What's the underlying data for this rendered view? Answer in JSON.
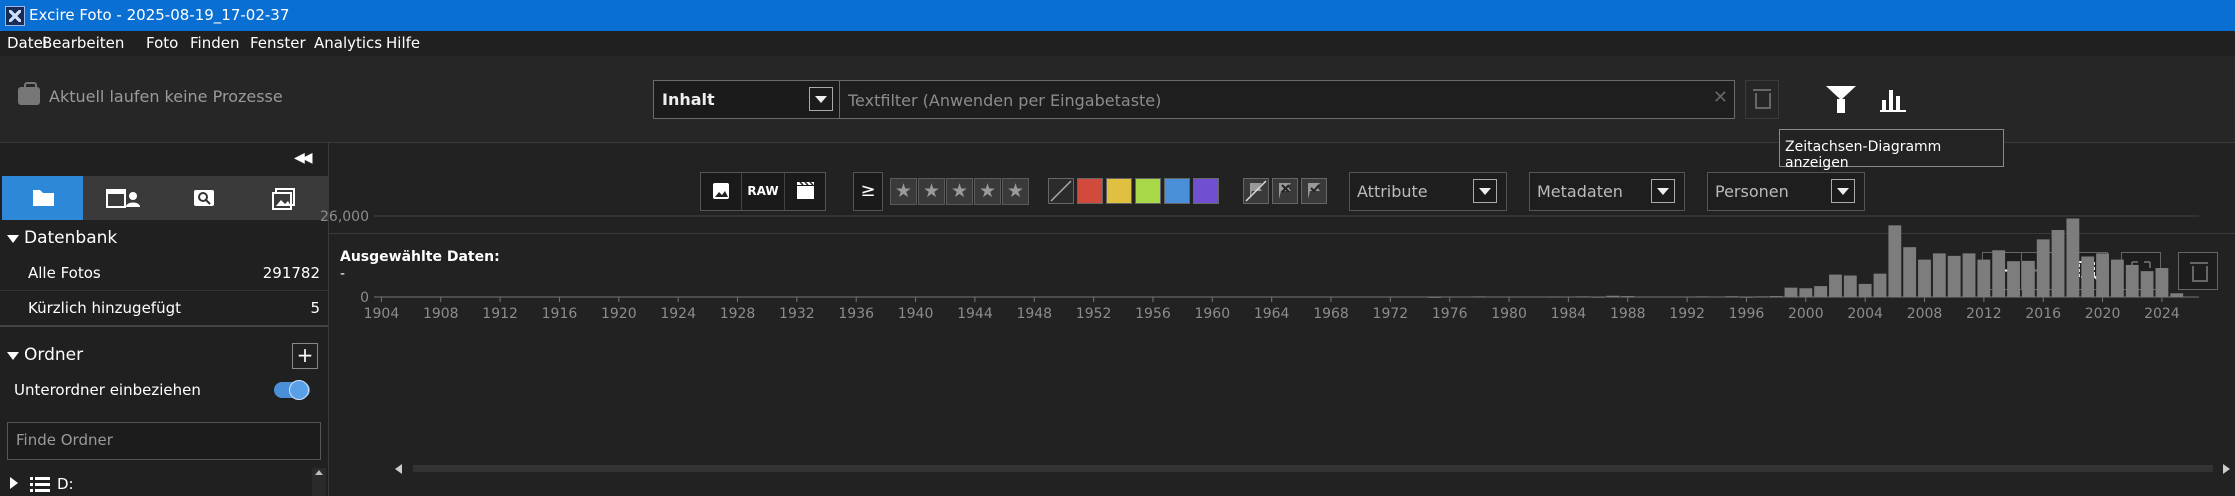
{
  "window": {
    "title": "Excire Foto - 2025-08-19_17-02-37"
  },
  "menu": [
    "Datei",
    "Bearbeiten",
    "Foto",
    "Finden",
    "Fenster",
    "Analytics",
    "Hilfe"
  ],
  "toolbar": {
    "process_status": "Aktuell laufen keine Prozesse",
    "scope_selected": "Inhalt",
    "textfilter_placeholder": "Textfilter (Anwenden per Eingabetaste)",
    "tooltip": "Zeitachsen-Diagramm anzeigen",
    "icons": {
      "process": "briefcase-icon",
      "filter": "funnel-icon",
      "timeline": "bar-chart-icon",
      "delete": "trash-icon"
    }
  },
  "sidebar": {
    "tabs": [
      {
        "icon": "folder-icon",
        "active": true
      },
      {
        "icon": "calendar-person-icon",
        "active": false
      },
      {
        "icon": "search-box-icon",
        "active": false
      },
      {
        "icon": "collection-icon",
        "active": false
      }
    ],
    "datenbank": {
      "title": "Datenbank",
      "items": [
        {
          "label": "Alle Fotos",
          "count": "291782"
        },
        {
          "label": "Kürzlich hinzugefügt",
          "count": "5"
        }
      ]
    },
    "ordner": {
      "title": "Ordner",
      "include_subfolders_label": "Unterordner einbeziehen",
      "include_subfolders": true,
      "search_placeholder": "Finde Ordner",
      "tree": [
        {
          "label": "D:"
        }
      ]
    }
  },
  "filterbar": {
    "type_buttons": [
      "image-icon",
      "RAW",
      "video-icon"
    ],
    "rating_operator": "≥",
    "stars": 5,
    "colors": [
      "#888888",
      "#d24a3c",
      "#e0c040",
      "#a8d848",
      "#4a90d9",
      "#7050d0"
    ],
    "flags": [
      "no-flag-icon",
      "rejected-flag-icon",
      "picked-flag-icon"
    ],
    "dropdowns": [
      "Attribute",
      "Metadaten",
      "Personen"
    ]
  },
  "chart": {
    "selected_title": "Ausgewählte Daten:",
    "selected_value": "-"
  },
  "chart_data": {
    "type": "bar",
    "title": "",
    "xlabel": "",
    "ylabel": "",
    "ylim": [
      0,
      26000
    ],
    "ytick_labels": [
      "26,000",
      "0"
    ],
    "xtick_labels": [
      "1904",
      "1908",
      "1912",
      "1916",
      "1920",
      "1924",
      "1928",
      "1932",
      "1936",
      "1940",
      "1944",
      "1948",
      "1952",
      "1956",
      "1960",
      "1964",
      "1968",
      "1972",
      "1976",
      "1980",
      "1984",
      "1988",
      "1992",
      "1996",
      "2000",
      "2004",
      "2008",
      "2012",
      "2016",
      "2020",
      "2024"
    ],
    "x": [
      1975,
      1978,
      1983,
      1985,
      1986,
      1987,
      1988,
      1993,
      1995,
      1996,
      1997,
      1998,
      1999,
      2000,
      2001,
      2002,
      2003,
      2004,
      2005,
      2006,
      2007,
      2008,
      2009,
      2010,
      2011,
      2012,
      2013,
      2014,
      2015,
      2016,
      2017,
      2018,
      2019,
      2020,
      2021,
      2022,
      2023,
      2024,
      2025
    ],
    "values": [
      50,
      200,
      150,
      200,
      100,
      400,
      300,
      200,
      250,
      100,
      200,
      300,
      400,
      600,
      2200,
      3000,
      2800,
      3500,
      7200,
      6900,
      4200,
      7500,
      23000,
      16000,
      12000,
      14000,
      13200,
      14000,
      12000,
      15000,
      11500,
      11600,
      18500,
      21500,
      25200,
      13000,
      14000,
      12000,
      10300,
      8300,
      9300,
      1200
    ]
  }
}
